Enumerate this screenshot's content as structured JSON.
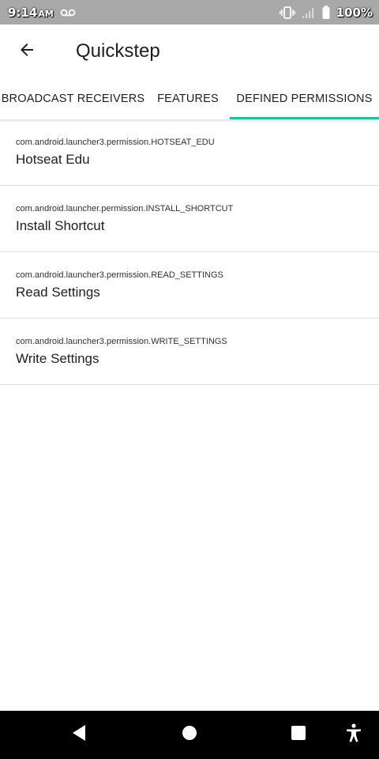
{
  "status_bar": {
    "time": "9:14",
    "ampm": "AM",
    "battery": "100%",
    "icons": [
      "voicemail-icon",
      "vibrate-icon",
      "signal-icon",
      "battery-icon"
    ]
  },
  "app_bar": {
    "title": "Quickstep",
    "back_icon": "arrow-left-icon"
  },
  "tabs": [
    {
      "label": "BROADCAST RECEIVERS",
      "active": false
    },
    {
      "label": "FEATURES",
      "active": false
    },
    {
      "label": "DEFINED PERMISSIONS",
      "active": true
    }
  ],
  "colors": {
    "accent": "#1fbfa0",
    "status_bar": "#a8a8a8",
    "nav_bar": "#000000"
  },
  "permissions": [
    {
      "id": "com.android.launcher3.permission.HOTSEAT_EDU",
      "name": "Hotseat Edu"
    },
    {
      "id": "com.android.launcher.permission.INSTALL_SHORTCUT",
      "name": "Install Shortcut"
    },
    {
      "id": "com.android.launcher3.permission.READ_SETTINGS",
      "name": "Read Settings"
    },
    {
      "id": "com.android.launcher3.permission.WRITE_SETTINGS",
      "name": "Write Settings"
    }
  ],
  "nav_bar": {
    "icons": [
      "back-triangle-icon",
      "home-circle-icon",
      "recents-square-icon",
      "accessibility-icon"
    ]
  }
}
